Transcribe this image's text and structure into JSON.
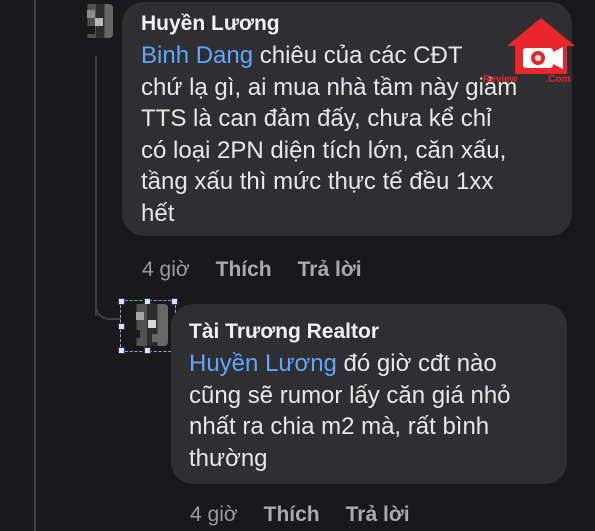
{
  "comments": [
    {
      "author": "Huyền Lương",
      "mention": "Binh Dang",
      "lines": [
        " chiêu của các CĐT",
        "chứ lạ gì, ai mua nhà tầm này giảm",
        "TTS là can đảm đấy, chưa kể chỉ",
        "có loại 2PN diện tích lớn, căn xấu,",
        "tầng xấu thì mức thực tế đều 1xx",
        "hết"
      ],
      "time": "4 giờ",
      "like_label": "Thích",
      "reply_label": "Trả lời"
    },
    {
      "author": "Tài Trương Realtor",
      "mention": "Huyền Lương",
      "lines": [
        " đó giờ cđt nào",
        "cũng sẽ rumor lấy căn giá nhỏ",
        "nhất ra chia m2 mà, rất bình",
        "thường"
      ],
      "time": "4 giờ",
      "like_label": "Thích",
      "reply_label": "Trả lời"
    }
  ],
  "watermark": {
    "text": "Review",
    "suffix": ".Com",
    "color": "#e8262b"
  },
  "colors": {
    "background": "#19191b",
    "bubble": "#2f2f31",
    "mention": "#5fa5ff"
  }
}
